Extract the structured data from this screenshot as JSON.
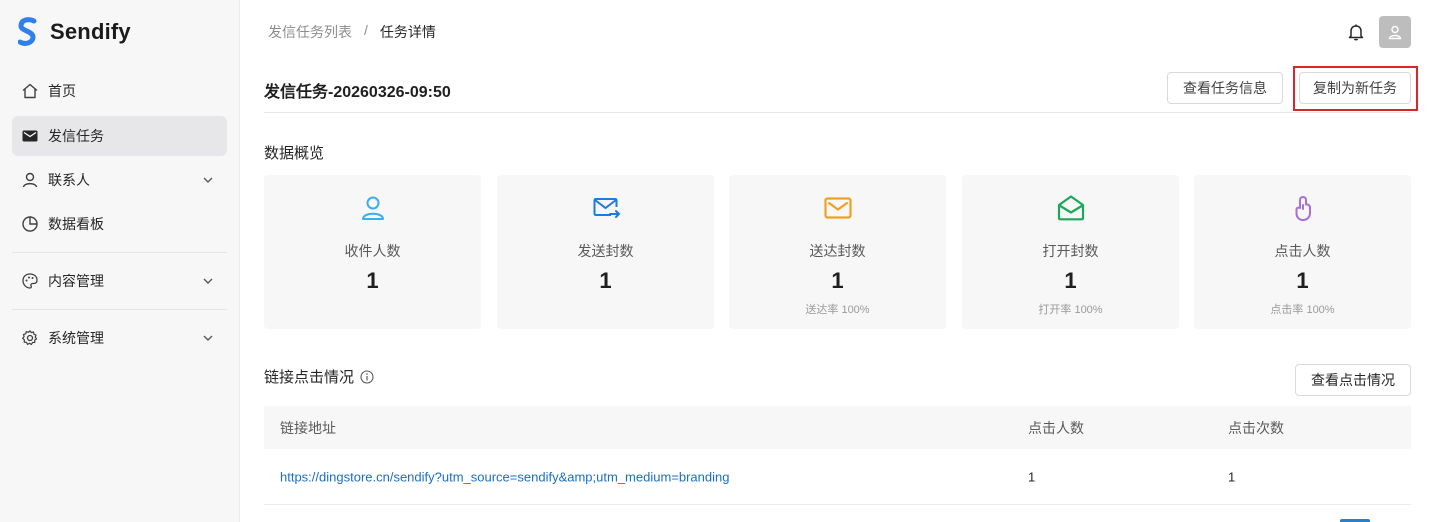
{
  "app": {
    "brand": "Sendify",
    "brand_color": "#2f80ed"
  },
  "sidebar": {
    "items": [
      {
        "label": "首页",
        "icon": "home-icon"
      },
      {
        "label": "发信任务",
        "icon": "mail-icon",
        "active": true
      },
      {
        "label": "联系人",
        "icon": "user-icon",
        "expandable": true
      },
      {
        "label": "数据看板",
        "icon": "pie-chart-icon"
      },
      {
        "label": "内容管理",
        "icon": "palette-icon",
        "expandable": true
      },
      {
        "label": "系统管理",
        "icon": "gear-icon",
        "expandable": true
      }
    ]
  },
  "header": {
    "breadcrumb": [
      "发信任务列表",
      "任务详情"
    ],
    "separator": "/"
  },
  "page": {
    "title": "发信任务-20260326-09:50",
    "view_task_button": "查看任务信息",
    "copy_task_button": "复制为新任务"
  },
  "overview": {
    "title": "数据概览",
    "cards": [
      {
        "label": "收件人数",
        "value": "1",
        "rate": "",
        "icon": "recipient-icon",
        "color": "#3ab0e8"
      },
      {
        "label": "发送封数",
        "value": "1",
        "rate": "",
        "icon": "mail-send-icon",
        "color": "#1e7ae0"
      },
      {
        "label": "送达封数",
        "value": "1",
        "rate": "送达率 100%",
        "icon": "mail-delivered-icon",
        "color": "#f2a023"
      },
      {
        "label": "打开封数",
        "value": "1",
        "rate": "打开率 100%",
        "icon": "mail-open-icon",
        "color": "#1aa85a"
      },
      {
        "label": "点击人数",
        "value": "1",
        "rate": "点击率 100%",
        "icon": "click-icon",
        "color": "#a86fd8"
      }
    ]
  },
  "links": {
    "title": "链接点击情况",
    "view_button": "查看点击情况",
    "columns": [
      "链接地址",
      "点击人数",
      "点击次数"
    ],
    "rows": [
      {
        "url": "https://dingstore.cn/sendify?utm_source=sendify&amp;utm_medium=branding",
        "people": "1",
        "count": "1"
      }
    ]
  }
}
